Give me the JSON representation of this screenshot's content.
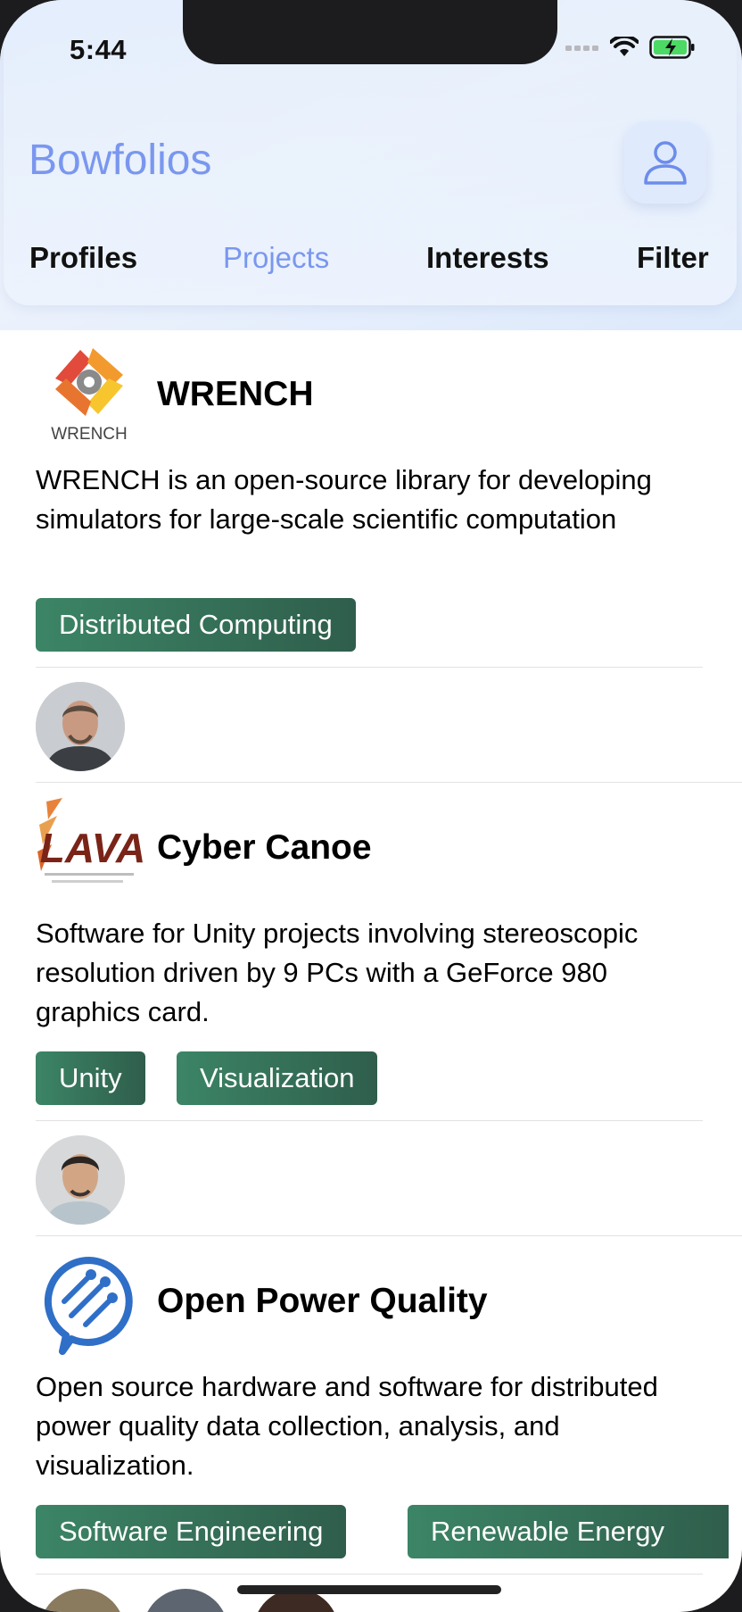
{
  "status": {
    "time": "5:44"
  },
  "header": {
    "title": "Bowfolios",
    "profile_icon": "user-icon"
  },
  "tabs": [
    {
      "label": "Profiles",
      "active": false
    },
    {
      "label": "Projects",
      "active": true
    },
    {
      "label": "Interests",
      "active": false
    },
    {
      "label": "Filter",
      "active": false
    }
  ],
  "projects": [
    {
      "name": "WRENCH",
      "logo_text": "WRENCH",
      "description": "WRENCH is an open-source library for developing simulators for large-scale scientific computation",
      "tags": [
        "Distributed Computing"
      ]
    },
    {
      "name": "Cyber Canoe",
      "logo_text": "LAVA",
      "description": "Software for Unity projects involving stereoscopic resolution driven by 9 PCs with a GeForce 980 graphics card.",
      "tags": [
        "Unity",
        "Visualization"
      ]
    },
    {
      "name": "Open Power Quality",
      "description": "Open source hardware and software for distributed power quality data collection, analysis, and visualization.",
      "tags": [
        "Software Engineering",
        "Renewable Energy"
      ]
    }
  ],
  "colors": {
    "accent": "#7a97ef",
    "tag": "#3c8566"
  }
}
